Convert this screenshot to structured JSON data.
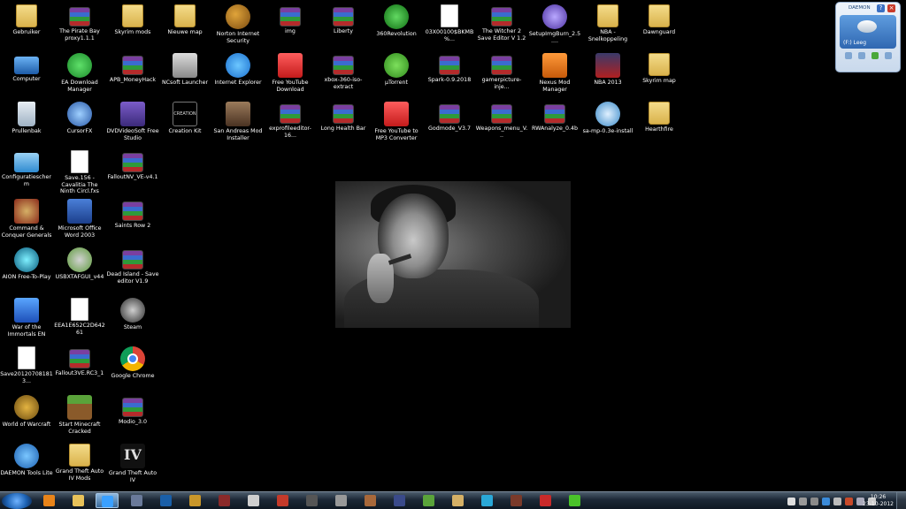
{
  "desktop": {
    "columns": [
      [
        {
          "label": "Gebruiker",
          "icon": "folder-icon",
          "style": "g-folder"
        },
        {
          "label": "Computer",
          "icon": "computer-icon",
          "style": "g-computer"
        },
        {
          "label": "Prullenbak",
          "icon": "recycle-bin-icon",
          "style": "g-bin"
        },
        {
          "label": "Configuratiescherm",
          "icon": "control-panel-icon",
          "style": "g-config"
        },
        {
          "label": "Command & Conquer Generals",
          "icon": "command-conquer-icon",
          "style": "g-cmd"
        },
        {
          "label": "AION Free-To-Play",
          "icon": "aion-icon",
          "style": "g-aion"
        },
        {
          "label": "War of the Immortals EN",
          "icon": "woi-icon",
          "style": "g-blue"
        },
        {
          "label": "Save20120708181​3...",
          "icon": "document-icon",
          "style": "g-doc"
        },
        {
          "label": "World of Warcraft",
          "icon": "warcraft-icon",
          "style": "g-world"
        },
        {
          "label": "DAEMON Tools Lite",
          "icon": "daemon-tools-icon",
          "style": "g-daemon"
        }
      ],
      [
        {
          "label": "The Pirate Bay proxy1.1.1",
          "icon": "archive-icon",
          "style": "g-rar"
        },
        {
          "label": "EA Download Manager",
          "icon": "ea-icon",
          "style": "g-ea"
        },
        {
          "label": "CursorFX",
          "icon": "cursorfx-icon",
          "style": "g-cursor"
        },
        {
          "label": "Save.156 - Cavalitia The Ninth Circl.fxs",
          "icon": "document-icon",
          "style": "g-doc"
        },
        {
          "label": "Microsoft Office Word 2003",
          "icon": "word-icon",
          "style": "g-word"
        },
        {
          "label": "USBXTAFGUI_v44",
          "icon": "xbox-icon",
          "style": "g-xbox"
        },
        {
          "label": "EEA1E652C2D64261",
          "icon": "document-icon",
          "style": "g-doc"
        },
        {
          "label": "Fallout3VE.RC3_1",
          "icon": "archive-icon",
          "style": "g-rar"
        },
        {
          "label": "Start Minecraft Cracked",
          "icon": "minecraft-icon",
          "style": "g-minecraft"
        },
        {
          "label": "Grand Theft Auto IV Mods",
          "icon": "folder-icon",
          "style": "g-folder"
        }
      ],
      [
        {
          "label": "Skyrim mods",
          "icon": "folder-icon",
          "style": "g-folder"
        },
        {
          "label": "APB_MoneyHack",
          "icon": "archive-icon",
          "style": "g-rar"
        },
        {
          "label": "DVDVideoSoft Free Studio",
          "icon": "dvdvideosoft-icon",
          "style": "g-purple"
        },
        {
          "label": "FalloutNV_VE-v4.1",
          "icon": "archive-icon",
          "style": "g-rar"
        },
        {
          "label": "Saints Row 2",
          "icon": "archive-icon",
          "style": "g-rar"
        },
        {
          "label": "Dead Island - Save editor V1.9",
          "icon": "archive-icon",
          "style": "g-rar"
        },
        {
          "label": "Steam",
          "icon": "steam-icon",
          "style": "g-steam"
        },
        {
          "label": "Google Chrome",
          "icon": "chrome-icon",
          "style": "g-chrome"
        },
        {
          "label": "Modio_3.0",
          "icon": "archive-icon",
          "style": "g-rar"
        },
        {
          "label": "Grand Theft Auto IV",
          "icon": "gta4-icon",
          "style": "g-gta4",
          "glyph_text": "IV"
        }
      ],
      [
        {
          "label": "Nieuwe map",
          "icon": "folder-icon",
          "style": "g-folder"
        },
        {
          "label": "NCsoft Launcher",
          "icon": "ncsoft-icon",
          "style": "g-ncsoft"
        },
        {
          "label": "Creation Kit",
          "icon": "creation-kit-icon",
          "style": "g-creation",
          "glyph_text": "CREATION"
        }
      ],
      [
        {
          "label": "Norton Internet Security",
          "icon": "norton-icon",
          "style": "g-globe"
        },
        {
          "label": "Internet Explorer",
          "icon": "internet-explorer-icon",
          "style": "g-ie"
        },
        {
          "label": "San Andreas Mod Installer",
          "icon": "san-andreas-icon",
          "style": "g-face"
        }
      ],
      [
        {
          "label": "img",
          "icon": "archive-icon",
          "style": "g-rar"
        },
        {
          "label": "Free YouTube Download",
          "icon": "youtube-download-icon",
          "style": "g-red"
        },
        {
          "label": "exprofileeditor-16...",
          "icon": "archive-icon",
          "style": "g-rar"
        }
      ],
      [
        {
          "label": "Liberty",
          "icon": "archive-icon",
          "style": "g-rar"
        },
        {
          "label": "xbox-360-iso-extract",
          "icon": "archive-icon",
          "style": "g-rar"
        },
        {
          "label": "Long Health Bar",
          "icon": "archive-icon",
          "style": "g-rar"
        }
      ],
      [
        {
          "label": "360Revolution",
          "icon": "360revolution-icon",
          "style": "g-360"
        },
        {
          "label": "µTorrent",
          "icon": "utorrent-icon",
          "style": "g-utor"
        },
        {
          "label": "Free YouTube to MP3 Converter",
          "icon": "youtube-mp3-icon",
          "style": "g-red"
        }
      ],
      [
        {
          "label": "03X00100$BKMB%...",
          "icon": "document-icon",
          "style": "g-doc"
        },
        {
          "label": "Spark-0.9.2018",
          "icon": "archive-icon",
          "style": "g-rar"
        },
        {
          "label": "Godmode_V3.7",
          "icon": "archive-icon",
          "style": "g-rar"
        }
      ],
      [
        {
          "label": "The Witcher 2 Save Editor V 1.2",
          "icon": "archive-icon",
          "style": "g-rar"
        },
        {
          "label": "gamerpicture-inje...",
          "icon": "archive-icon",
          "style": "g-rar"
        },
        {
          "label": "Weapons_menu_V...",
          "icon": "archive-icon",
          "style": "g-rar"
        }
      ],
      [
        {
          "label": "SetupImgBurn_2.5....",
          "icon": "imgburn-icon",
          "style": "g-setup"
        },
        {
          "label": "Nexus Mod Manager",
          "icon": "nexus-icon",
          "style": "g-orange"
        },
        {
          "label": "RWAnalyze_0.4b",
          "icon": "archive-icon",
          "style": "g-rar"
        }
      ],
      [
        {
          "label": "NBA - Snelkoppeling",
          "icon": "folder-icon",
          "style": "g-folder"
        },
        {
          "label": "NBA 2013",
          "icon": "nba-icon",
          "style": "g-nba"
        },
        {
          "label": "sa-mp-0.3e-install",
          "icon": "samp-icon",
          "style": "g-hal"
        }
      ],
      [
        {
          "label": "Dawnguard",
          "icon": "folder-icon",
          "style": "g-folder"
        },
        {
          "label": "Skyrim map",
          "icon": "folder-icon",
          "style": "g-folder"
        },
        {
          "label": "Hearthfire",
          "icon": "folder-icon",
          "style": "g-folder"
        }
      ]
    ]
  },
  "gadget": {
    "title": "DAEMON",
    "drive_label": "(F:) Leeg"
  },
  "taskbar": {
    "pinned": [
      {
        "name": "media-player",
        "color": "#e8841a"
      },
      {
        "name": "explorer",
        "color": "#e8c25a"
      },
      {
        "name": "internet-explorer",
        "color": "#3aa0ff",
        "active": true
      },
      {
        "name": "woi",
        "color": "#6a7a9a"
      },
      {
        "name": "photoshop",
        "color": "#1a5fa8"
      },
      {
        "name": "warcraft",
        "color": "#c8962a"
      },
      {
        "name": "app-skull",
        "color": "#8a2a2a"
      },
      {
        "name": "skyrim",
        "color": "#cfcfcf"
      },
      {
        "name": "app-red",
        "color": "#c43a2a"
      },
      {
        "name": "app-dark",
        "color": "#555555"
      },
      {
        "name": "gta4",
        "color": "#999999"
      },
      {
        "name": "app-face",
        "color": "#a8683a"
      },
      {
        "name": "app-shield",
        "color": "#3a4a8a"
      },
      {
        "name": "minecraft",
        "color": "#5aa33a"
      },
      {
        "name": "command-conquer",
        "color": "#d5b066"
      },
      {
        "name": "aion",
        "color": "#2aa8d8"
      },
      {
        "name": "app-face2",
        "color": "#7a3a2a"
      },
      {
        "name": "app-gear",
        "color": "#c82a2a"
      },
      {
        "name": "utorrent",
        "color": "#4ac22a"
      }
    ],
    "clock_time": "10:26",
    "clock_date": "23-10-2012"
  }
}
